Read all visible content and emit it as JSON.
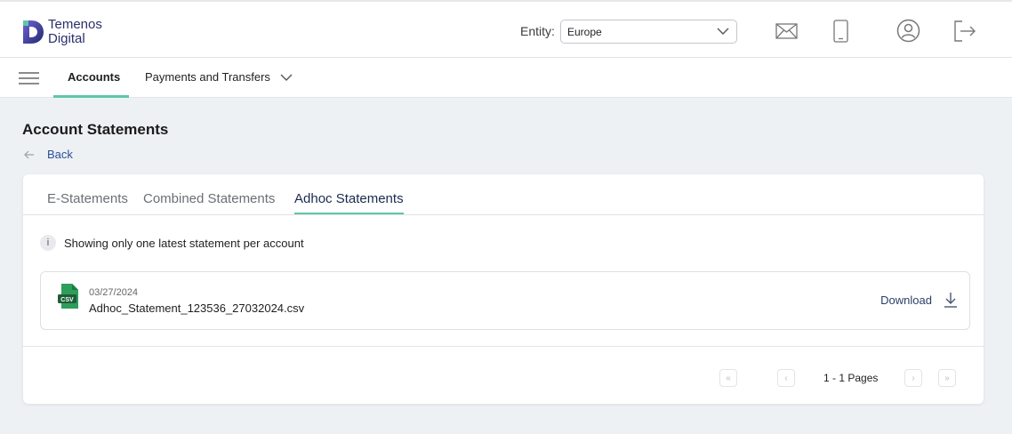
{
  "header": {
    "brand_line1": "Temenos",
    "brand_line2": "Digital",
    "entity_label": "Entity:",
    "entity_value": "Europe",
    "icons": [
      "mail-icon",
      "mobile-icon",
      "user-profile-icon",
      "logout-icon"
    ]
  },
  "nav": {
    "menu_icon": "hamburger-menu-icon",
    "tabs": [
      {
        "label": "Accounts",
        "active": true
      },
      {
        "label": "Payments and Transfers",
        "active": false
      }
    ]
  },
  "page": {
    "title": "Account Statements",
    "back_label": "Back"
  },
  "statements": {
    "tabs": [
      {
        "label": "E-Statements",
        "active": false
      },
      {
        "label": "Combined Statements",
        "active": false
      },
      {
        "label": "Adhoc Statements",
        "active": true
      }
    ],
    "info_icon_text": "i",
    "info_text": "Showing only one latest statement per account",
    "files": [
      {
        "date": "03/27/2024",
        "name": "Adhoc_Statement_123536_27032024.csv",
        "type_badge": "CSV",
        "action": "Download"
      }
    ]
  },
  "pagination": {
    "text": "1 - 1 Pages",
    "first": "«",
    "prev": "‹",
    "next": "›",
    "last": "»"
  },
  "colors": {
    "accent_green": "#5ec6a8",
    "brand_navy": "#2b2f6b",
    "link_blue": "#2a4f9a",
    "csv_green": "#2e9e5b"
  }
}
